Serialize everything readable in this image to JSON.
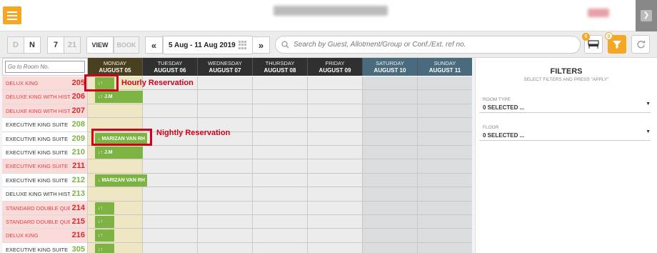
{
  "header": {
    "menu_icon": "hamburger-icon"
  },
  "toolbar": {
    "day_label": "D",
    "night_label": "N",
    "seven_label": "7",
    "twentyone_label": "21",
    "view_label": "VIEW",
    "book_label": "BOOK",
    "date_range": "5 Aug - 11 Aug 2019",
    "search_placeholder": "Search by Guest, Allotment/Group or Conf./Ext. ref no.",
    "badge_count_1": "0",
    "badge_count_2": "0"
  },
  "grid": {
    "room_search_placeholder": "Go to Room No.",
    "days": [
      {
        "name": "MONDAY",
        "date": "AUGUST 05"
      },
      {
        "name": "TUESDAY",
        "date": "AUGUST 06"
      },
      {
        "name": "WEDNESDAY",
        "date": "AUGUST 07"
      },
      {
        "name": "THURSDAY",
        "date": "AUGUST 08"
      },
      {
        "name": "FRIDAY",
        "date": "AUGUST 09"
      },
      {
        "name": "SATURDAY",
        "date": "AUGUST 10"
      },
      {
        "name": "SUNDAY",
        "date": "AUGUST 11"
      }
    ],
    "rooms": [
      {
        "type": "DELUX KING",
        "number": "205",
        "status": "red"
      },
      {
        "type": "DELUXE KING WITH HISTORIC",
        "number": "206",
        "status": "red"
      },
      {
        "type": "DELUXE KING WITH HISTORIC",
        "number": "207",
        "status": "red"
      },
      {
        "type": "EXECUTIVE KING SUITE",
        "number": "208",
        "status": "normal"
      },
      {
        "type": "EXECUTIVE KING SUITE",
        "number": "209",
        "status": "normal"
      },
      {
        "type": "EXECUTIVE KING SUITE",
        "number": "210",
        "status": "normal"
      },
      {
        "type": "EXECUTIVE KING SUITE",
        "number": "211",
        "status": "red"
      },
      {
        "type": "EXECUTIVE KING SUITE",
        "number": "212",
        "status": "normal"
      },
      {
        "type": "DELUXE KING WITH HISTORIC",
        "number": "213",
        "status": "normal"
      },
      {
        "type": "STANDARD DOUBLE QUEEN",
        "number": "214",
        "status": "red"
      },
      {
        "type": "STANDARD DOUBLE QUEEN",
        "number": "215",
        "status": "red"
      },
      {
        "type": "DELUX KING",
        "number": "216",
        "status": "red"
      },
      {
        "type": "EXECUTIVE KING SUITE",
        "number": "305",
        "status": "normal"
      }
    ],
    "reservations": [
      {
        "row": 0,
        "label": "↓↑",
        "kind": "hourly"
      },
      {
        "row": 1,
        "label": "↓↑  J.M",
        "kind": "hourly-wide"
      },
      {
        "row": 4,
        "label": "↓   MARIZAN VAN RH",
        "kind": "nightly"
      },
      {
        "row": 5,
        "label": "↓↑  J.M",
        "kind": "hourly-wide"
      },
      {
        "row": 7,
        "label": "↓   MARIZAN VAN RH",
        "kind": "nightly"
      },
      {
        "row": 9,
        "label": "↓↑",
        "kind": "hourly"
      },
      {
        "row": 10,
        "label": "↓↑",
        "kind": "hourly"
      },
      {
        "row": 11,
        "label": "↓↑",
        "kind": "hourly"
      },
      {
        "row": 12,
        "label": "↓↑",
        "kind": "hourly"
      }
    ]
  },
  "annotations": {
    "hourly": "Hourly Reservation",
    "nightly": "Nightly Reservation"
  },
  "filters": {
    "title": "FILTERS",
    "subtitle": "SELECT FILTERS AND PRESS \"APPLY\"",
    "room_type_label": "ROOM TYPE",
    "room_type_value": "0 SELECTED ...",
    "floor_label": "FLOOR",
    "floor_value": "0 SELECTED ..."
  },
  "colors": {
    "accent": "#f5a623",
    "reservation_green": "#7cb342",
    "annotation_red": "#d0021b"
  }
}
